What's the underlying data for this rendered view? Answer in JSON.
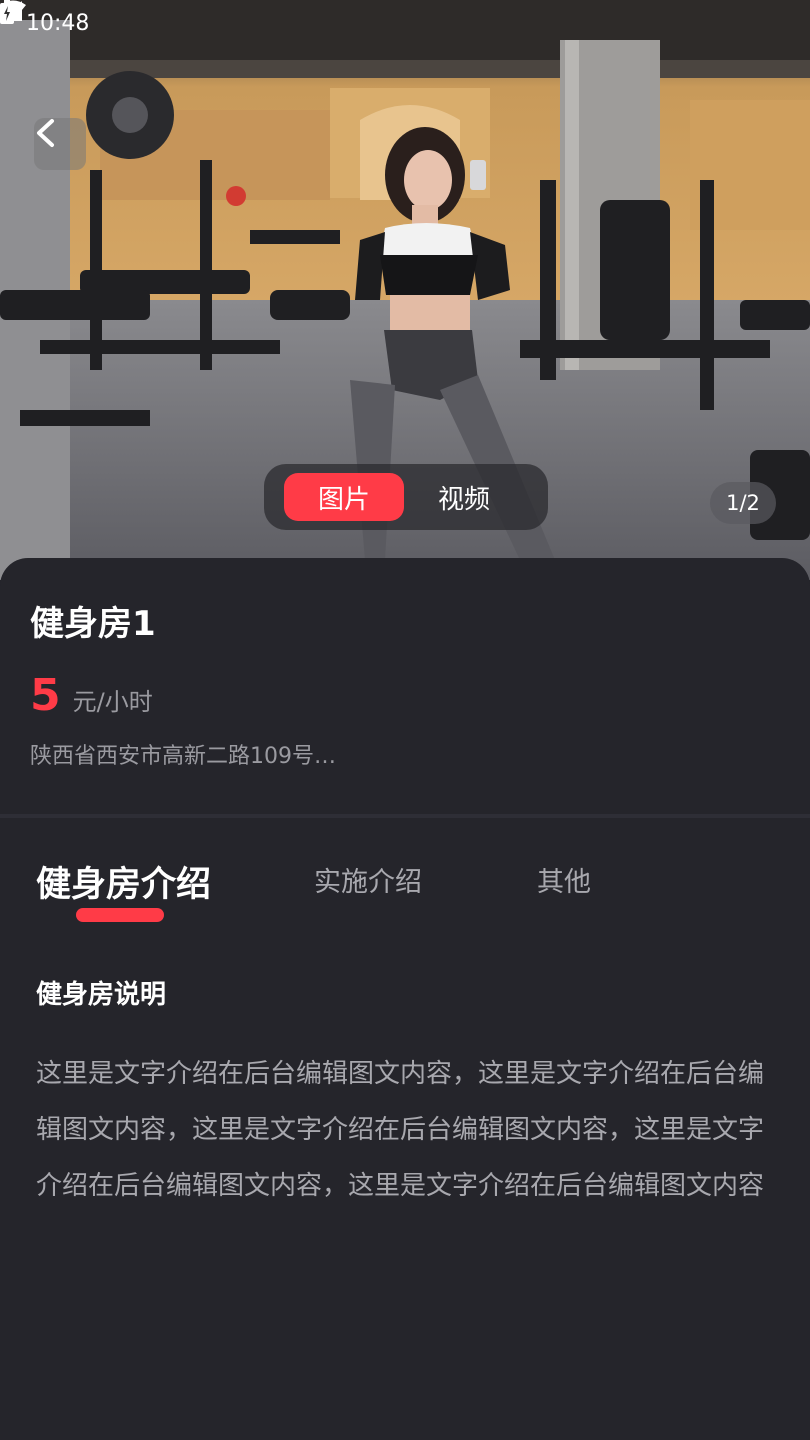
{
  "status_bar": {
    "time": "10:48",
    "icons": [
      "wifi-icon",
      "signal-icon",
      "battery-icon"
    ]
  },
  "hero": {
    "media_tabs": [
      {
        "label": "图片",
        "active": true
      },
      {
        "label": "视频",
        "active": false
      }
    ],
    "page_counter": "1/2"
  },
  "venue": {
    "title": "健身房1",
    "price": "5",
    "price_unit": "元/小时",
    "address": "陕西省西安市高新二路109号…"
  },
  "tabs": [
    {
      "label": "健身房介绍",
      "active": true
    },
    {
      "label": "实施介绍",
      "active": false
    },
    {
      "label": "其他",
      "active": false
    }
  ],
  "content": {
    "heading": "健身房说明",
    "body": "这里是文字介绍在后台编辑图文内容，这里是文字介绍在后台编辑图文内容，这里是文字介绍在后台编辑图文内容，这里是文字介绍在后台编辑图文内容，这里是文字介绍在后台编辑图文内容"
  },
  "colors": {
    "accent": "#ff3b47",
    "background": "#25252b",
    "muted_text": "#9a9aa0"
  }
}
